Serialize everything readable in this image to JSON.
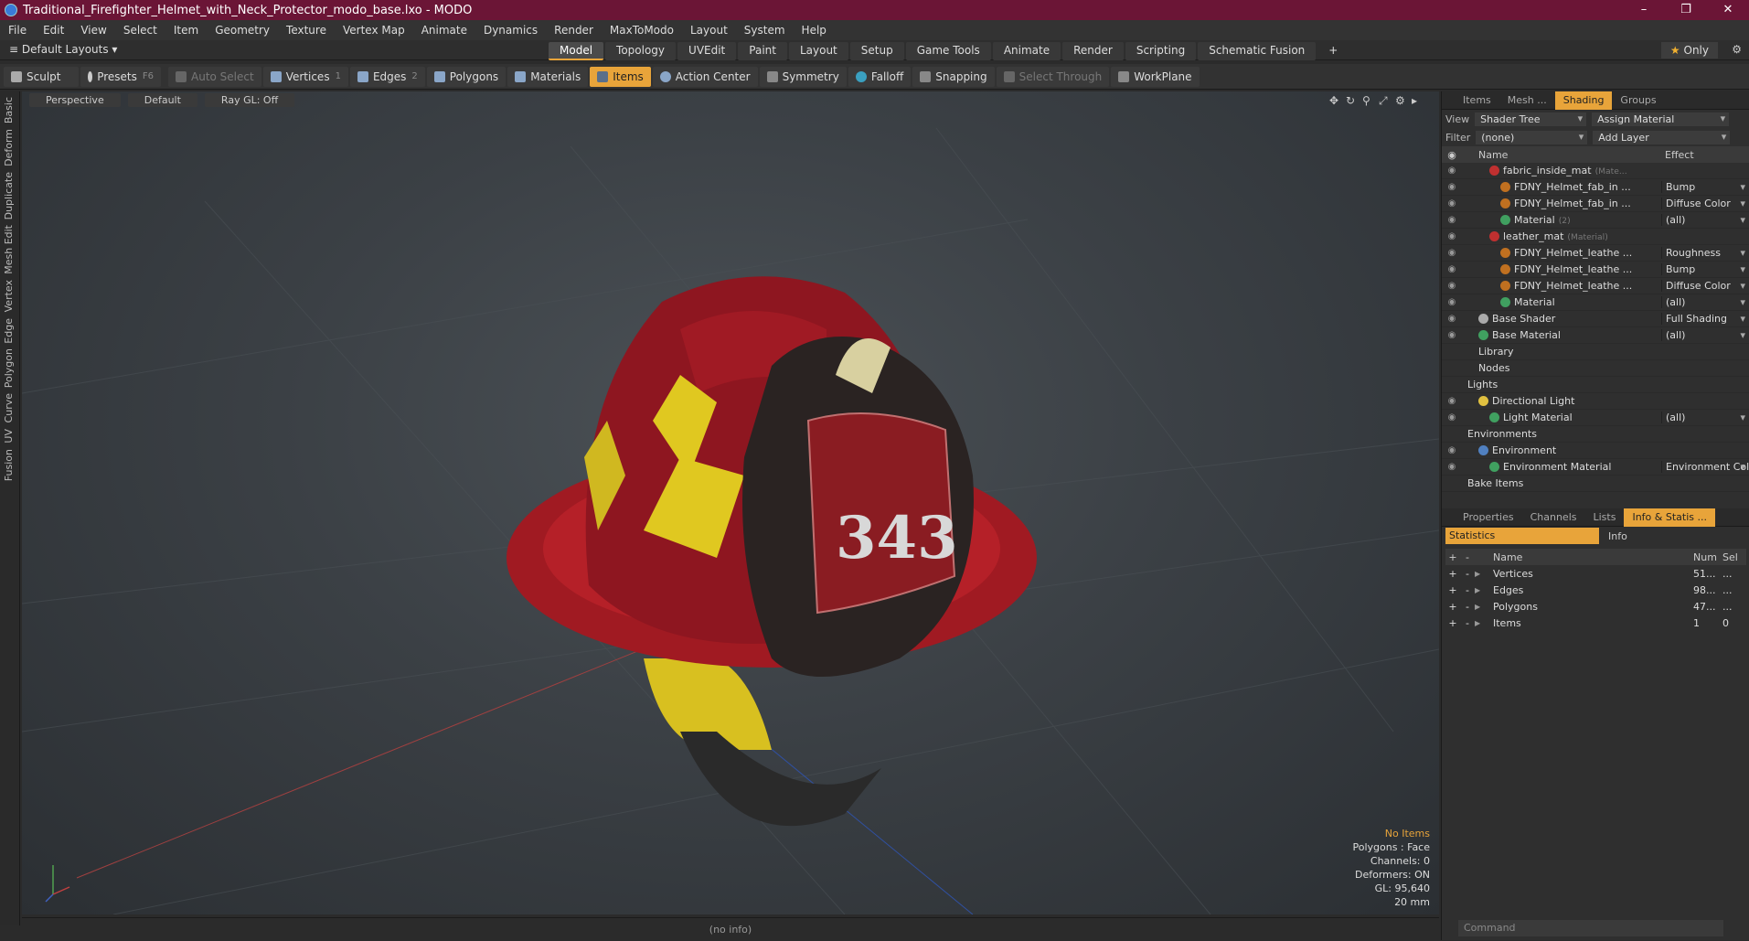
{
  "window": {
    "title": "Traditional_Firefighter_Helmet_with_Neck_Protector_modo_base.lxo - MODO"
  },
  "menu": [
    "File",
    "Edit",
    "View",
    "Select",
    "Item",
    "Geometry",
    "Texture",
    "Vertex Map",
    "Animate",
    "Dynamics",
    "Render",
    "MaxToModo",
    "Layout",
    "System",
    "Help"
  ],
  "modebar": {
    "layouts": "Default Layouts",
    "tabs": [
      "Model",
      "Topology",
      "UVEdit",
      "Paint",
      "Layout",
      "Setup",
      "Game Tools",
      "Animate",
      "Render",
      "Scripting",
      "Schematic Fusion"
    ],
    "active_tab": "Model",
    "plus": "+",
    "only": "Only"
  },
  "toolbar": {
    "sculpt": "Sculpt",
    "presets": "Presets",
    "presets_key": "F6",
    "auto_select": "Auto Select",
    "vertices": "Vertices",
    "vertices_count": "1",
    "edges": "Edges",
    "edges_count": "2",
    "polygons": "Polygons",
    "materials": "Materials",
    "items": "Items",
    "action_center": "Action Center",
    "symmetry": "Symmetry",
    "falloff": "Falloff",
    "snapping": "Snapping",
    "select_through": "Select Through",
    "workplane": "WorkPlane"
  },
  "left_tabs": [
    "Basic",
    "Deform",
    "Duplicate",
    "Mesh Edit",
    "Vertex",
    "Edge",
    "Polygon",
    "Curve",
    "UV",
    "Fusion"
  ],
  "viewport": {
    "perspective": "Perspective",
    "shading": "Default",
    "raygl": "Ray GL: Off",
    "hud": {
      "no_items": "No Items",
      "polygons": "Polygons : Face",
      "channels": "Channels: 0",
      "deformers": "Deformers: ON",
      "gl": "GL: 95,640",
      "size": "20 mm"
    }
  },
  "status": "(no info)",
  "shading_panel": {
    "tabs": [
      "Items",
      "Mesh ...",
      "Shading",
      "Groups"
    ],
    "active": "Shading",
    "view_label": "View",
    "view_value": "Shader Tree",
    "assign": "Assign Material",
    "filter_label": "Filter",
    "filter_value": "(none)",
    "add_layer": "Add Layer",
    "col_name": "Name",
    "col_effect": "Effect",
    "rows": [
      {
        "name": "fabric_inside_mat",
        "tag": "(Mate...",
        "effect": "",
        "indent": 2,
        "dot": "#c03030"
      },
      {
        "name": "FDNY_Helmet_fab_in ...",
        "tag": "",
        "effect": "Bump",
        "indent": 3,
        "dot": "#c07020"
      },
      {
        "name": "FDNY_Helmet_fab_in ...",
        "tag": "",
        "effect": "Diffuse Color",
        "indent": 3,
        "dot": "#c07020"
      },
      {
        "name": "Material",
        "tag": "(2)",
        "effect": "(all)",
        "indent": 3,
        "dot": "#40a060"
      },
      {
        "name": "leather_mat",
        "tag": "(Material)",
        "effect": "",
        "indent": 2,
        "dot": "#c03030"
      },
      {
        "name": "FDNY_Helmet_leathe ...",
        "tag": "",
        "effect": "Roughness",
        "indent": 3,
        "dot": "#c07020"
      },
      {
        "name": "FDNY_Helmet_leathe ...",
        "tag": "",
        "effect": "Bump",
        "indent": 3,
        "dot": "#c07020"
      },
      {
        "name": "FDNY_Helmet_leathe ...",
        "tag": "",
        "effect": "Diffuse Color",
        "indent": 3,
        "dot": "#c07020"
      },
      {
        "name": "Material",
        "tag": "",
        "effect": "(all)",
        "indent": 3,
        "dot": "#40a060"
      },
      {
        "name": "Base Shader",
        "tag": "",
        "effect": "Full Shading",
        "indent": 1,
        "dot": "#aaaaaa"
      },
      {
        "name": "Base Material",
        "tag": "",
        "effect": "(all)",
        "indent": 1,
        "dot": "#40a060"
      },
      {
        "name": "Library",
        "tag": "",
        "effect": "",
        "indent": 1,
        "dot": ""
      },
      {
        "name": "Nodes",
        "tag": "",
        "effect": "",
        "indent": 1,
        "dot": ""
      },
      {
        "name": "Lights",
        "tag": "",
        "effect": "",
        "indent": 0,
        "dot": ""
      },
      {
        "name": "Directional Light",
        "tag": "",
        "effect": "",
        "indent": 1,
        "dot": "#e0c040"
      },
      {
        "name": "Light Material",
        "tag": "",
        "effect": "(all)",
        "indent": 2,
        "dot": "#40a060"
      },
      {
        "name": "Environments",
        "tag": "",
        "effect": "",
        "indent": 0,
        "dot": ""
      },
      {
        "name": "Environment",
        "tag": "",
        "effect": "",
        "indent": 1,
        "dot": "#5080c0"
      },
      {
        "name": "Environment Material",
        "tag": "",
        "effect": "Environment Col ...",
        "indent": 2,
        "dot": "#40a060"
      },
      {
        "name": "Bake Items",
        "tag": "",
        "effect": "",
        "indent": 0,
        "dot": ""
      }
    ]
  },
  "info_panel": {
    "tabs": [
      "Properties",
      "Channels",
      "Lists",
      "Info & Statis ..."
    ],
    "active": "Info & Statis ...",
    "statistics": "Statistics",
    "info": "Info",
    "col_name": "Name",
    "col_num": "Num",
    "col_sel": "Sel",
    "rows": [
      {
        "name": "Vertices",
        "num": "51...",
        "sel": "..."
      },
      {
        "name": "Edges",
        "num": "98...",
        "sel": "..."
      },
      {
        "name": "Polygons",
        "num": "47...",
        "sel": "..."
      },
      {
        "name": "Items",
        "num": "1",
        "sel": "0"
      }
    ],
    "command": "Command"
  }
}
